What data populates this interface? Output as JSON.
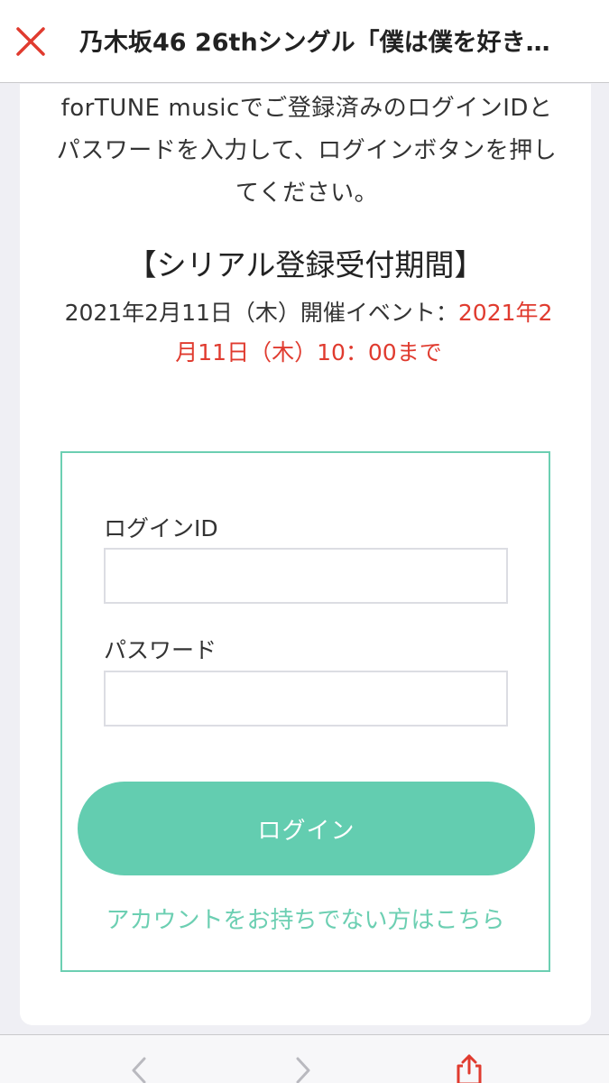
{
  "header": {
    "title": "乃木坂46 26thシングル「僕は僕を好き…",
    "close_icon": "close-icon",
    "close_color": "#e03b2f"
  },
  "content": {
    "intro": "forTUNE musicでご登録済みのログインIDとパスワードを入力して、ログインボタンを押してください。",
    "period_title": "【シリアル登録受付期間】",
    "period_prefix": "2021年2月11日（木）開催イベント：",
    "period_deadline": "2021年2月11日（木）10：00まで"
  },
  "login": {
    "id_label": "ログインID",
    "id_value": "",
    "password_label": "パスワード",
    "password_value": "",
    "button_label": "ログイン",
    "signup_link": "アカウントをお持ちでない方はこちら"
  },
  "toolbar": {
    "back_icon": "chevron-left-icon",
    "forward_icon": "chevron-right-icon",
    "share_icon": "share-icon"
  },
  "colors": {
    "accent": "#63cdb0",
    "deadline_red": "#e03b2f"
  }
}
